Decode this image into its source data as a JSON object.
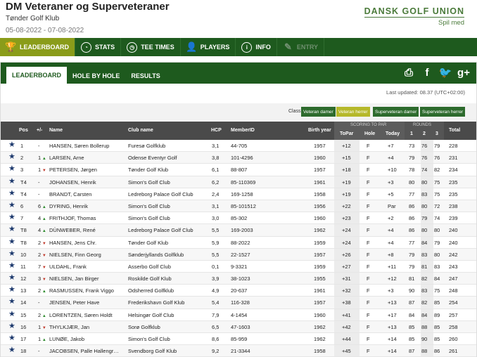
{
  "header": {
    "title": "DM Veteraner og Superveteraner",
    "club": "Tønder Golf Klub",
    "dates": "05-08-2022 - 07-08-2022",
    "brand_name": "DANSK GOLF UNION",
    "brand_tag": "Spil med"
  },
  "main_nav": [
    {
      "label": "LEADERBOARD",
      "icon": "trophy-icon"
    },
    {
      "label": "STATS",
      "icon": "pie-chart-icon"
    },
    {
      "label": "TEE TIMES",
      "icon": "clock-icon"
    },
    {
      "label": "PLAYERS",
      "icon": "person-icon"
    },
    {
      "label": "INFO",
      "icon": "info-icon"
    },
    {
      "label": "ENTRY",
      "icon": "pencil-icon"
    }
  ],
  "sub_nav": [
    "LEADERBOARD",
    "HOLE BY HOLE",
    "RESULTS"
  ],
  "social": {
    "print": "printer-icon",
    "facebook": "f",
    "twitter": "twitter-icon",
    "googleplus": "g+"
  },
  "last_updated": "Last updated: 08.37 (UTC+02:00)",
  "filter": {
    "label": "Class",
    "options": [
      "Veteran damer",
      "Veteran herrer",
      "Superveteran damer",
      "Superveteran herrer"
    ],
    "selected_index": 1
  },
  "columns": {
    "pos": "Pos",
    "move": "+/-",
    "name": "Name",
    "club": "Club name",
    "hcp": "HCP",
    "member": "MemberID",
    "birth": "Birth year",
    "scoring": "SCORING TO PAR",
    "topar": "ToPar",
    "hole": "Hole",
    "today": "Today",
    "rounds": "ROUNDS",
    "r1": "1",
    "r2": "2",
    "r3": "3",
    "total": "Total"
  },
  "rows": [
    {
      "pos": "1",
      "mv": "-",
      "dir": "",
      "name": "HANSEN, Søren Bollerup",
      "club": "Furesø Golfklub",
      "hcp": "3,1",
      "member": "44-705",
      "birth": "1957",
      "topar": "+12",
      "hole": "F",
      "today": "+7",
      "r1": "73",
      "r2": "76",
      "r3": "79",
      "total": "228"
    },
    {
      "pos": "2",
      "mv": "1",
      "dir": "up",
      "name": "LARSEN, Arne",
      "club": "Odense Eventyr Golf",
      "hcp": "3,8",
      "member": "101-4296",
      "birth": "1960",
      "topar": "+15",
      "hole": "F",
      "today": "+4",
      "r1": "79",
      "r2": "76",
      "r3": "76",
      "total": "231"
    },
    {
      "pos": "3",
      "mv": "1",
      "dir": "down",
      "name": "PETERSEN, Jørgen",
      "club": "Tønder Golf Klub",
      "hcp": "6,1",
      "member": "88-807",
      "birth": "1957",
      "topar": "+18",
      "hole": "F",
      "today": "+10",
      "r1": "78",
      "r2": "74",
      "r3": "82",
      "total": "234"
    },
    {
      "pos": "T4",
      "mv": "-",
      "dir": "",
      "name": "JOHANSEN, Henrik",
      "club": "Simon's Golf Club",
      "hcp": "6,2",
      "member": "85-110369",
      "birth": "1961",
      "topar": "+19",
      "hole": "F",
      "today": "+3",
      "r1": "80",
      "r2": "80",
      "r3": "75",
      "total": "235"
    },
    {
      "pos": "T4",
      "mv": "-",
      "dir": "",
      "name": "BRANDT, Carsten",
      "club": "Ledreborg Palace Golf Club",
      "hcp": "2,4",
      "member": "169-1258",
      "birth": "1958",
      "topar": "+19",
      "hole": "F",
      "today": "+5",
      "r1": "77",
      "r2": "83",
      "r3": "75",
      "total": "235"
    },
    {
      "pos": "6",
      "mv": "6",
      "dir": "up",
      "name": "DYRING, Henrik",
      "club": "Simon's Golf Club",
      "hcp": "3,1",
      "member": "85-101512",
      "birth": "1956",
      "topar": "+22",
      "hole": "F",
      "today": "Par",
      "r1": "86",
      "r2": "80",
      "r3": "72",
      "total": "238"
    },
    {
      "pos": "7",
      "mv": "4",
      "dir": "up",
      "name": "FRITHJOF, Thomas",
      "club": "Simon's Golf Club",
      "hcp": "3,0",
      "member": "85-302",
      "birth": "1960",
      "topar": "+23",
      "hole": "F",
      "today": "+2",
      "r1": "86",
      "r2": "79",
      "r3": "74",
      "total": "239"
    },
    {
      "pos": "T8",
      "mv": "4",
      "dir": "up",
      "name": "DÜNWEBER, René",
      "club": "Ledreborg Palace Golf Club",
      "hcp": "5,5",
      "member": "169-2003",
      "birth": "1962",
      "topar": "+24",
      "hole": "F",
      "today": "+4",
      "r1": "86",
      "r2": "80",
      "r3": "80",
      "total": "240"
    },
    {
      "pos": "T8",
      "mv": "2",
      "dir": "down",
      "name": "HANSEN, Jens Chr.",
      "club": "Tønder Golf Klub",
      "hcp": "5,9",
      "member": "88-2022",
      "birth": "1959",
      "topar": "+24",
      "hole": "F",
      "today": "+4",
      "r1": "77",
      "r2": "84",
      "r3": "79",
      "total": "240"
    },
    {
      "pos": "10",
      "mv": "2",
      "dir": "down",
      "name": "NIELSEN, Finn Georg",
      "club": "Sønderjyllands Golfklub",
      "hcp": "5,5",
      "member": "22-1527",
      "birth": "1957",
      "topar": "+26",
      "hole": "F",
      "today": "+8",
      "r1": "79",
      "r2": "83",
      "r3": "80",
      "total": "242"
    },
    {
      "pos": "11",
      "mv": "7",
      "dir": "down",
      "name": "ULDAHL, Frank",
      "club": "Asserbo Golf Club",
      "hcp": "0,1",
      "member": "9-3321",
      "birth": "1959",
      "topar": "+27",
      "hole": "F",
      "today": "+11",
      "r1": "79",
      "r2": "81",
      "r3": "83",
      "total": "243"
    },
    {
      "pos": "12",
      "mv": "3",
      "dir": "down",
      "name": "NIELSEN, Jan Birger",
      "club": "Roskilde Golf Klub",
      "hcp": "3,9",
      "member": "38-1023",
      "birth": "1955",
      "topar": "+31",
      "hole": "F",
      "today": "+12",
      "r1": "81",
      "r2": "82",
      "r3": "84",
      "total": "247"
    },
    {
      "pos": "13",
      "mv": "2",
      "dir": "up",
      "name": "RASMUSSEN, Frank Viggo",
      "club": "Odsherred Golfklub",
      "hcp": "4,9",
      "member": "20-637",
      "birth": "1961",
      "topar": "+32",
      "hole": "F",
      "today": "+3",
      "r1": "90",
      "r2": "83",
      "r3": "75",
      "total": "248"
    },
    {
      "pos": "14",
      "mv": "-",
      "dir": "",
      "name": "JENSEN, Peter Have",
      "club": "Frederikshavn Golf Klub",
      "hcp": "5,4",
      "member": "116-328",
      "birth": "1957",
      "topar": "+38",
      "hole": "F",
      "today": "+13",
      "r1": "87",
      "r2": "82",
      "r3": "85",
      "total": "254"
    },
    {
      "pos": "15",
      "mv": "2",
      "dir": "up",
      "name": "LORENTZEN, Søren Holdt",
      "club": "Helsingør Golf Club",
      "hcp": "7,9",
      "member": "4-1454",
      "birth": "1960",
      "topar": "+41",
      "hole": "F",
      "today": "+17",
      "r1": "84",
      "r2": "84",
      "r3": "89",
      "total": "257"
    },
    {
      "pos": "16",
      "mv": "1",
      "dir": "down",
      "name": "THYLKJÆR, Jan",
      "club": "Sorø Golfklub",
      "hcp": "6,5",
      "member": "47-1603",
      "birth": "1962",
      "topar": "+42",
      "hole": "F",
      "today": "+13",
      "r1": "85",
      "r2": "88",
      "r3": "85",
      "total": "258"
    },
    {
      "pos": "17",
      "mv": "1",
      "dir": "up",
      "name": "LUNØE, Jakob",
      "club": "Simon's Golf Club",
      "hcp": "8,6",
      "member": "85-959",
      "birth": "1962",
      "topar": "+44",
      "hole": "F",
      "today": "+14",
      "r1": "85",
      "r2": "90",
      "r3": "85",
      "total": "260"
    },
    {
      "pos": "18",
      "mv": "-",
      "dir": "",
      "name": "JACOBSEN, Palle Hallengr…",
      "club": "Svendborg Golf Klub",
      "hcp": "9,2",
      "member": "21-3344",
      "birth": "1958",
      "topar": "+45",
      "hole": "F",
      "today": "+14",
      "r1": "87",
      "r2": "88",
      "r3": "86",
      "total": "261"
    }
  ]
}
